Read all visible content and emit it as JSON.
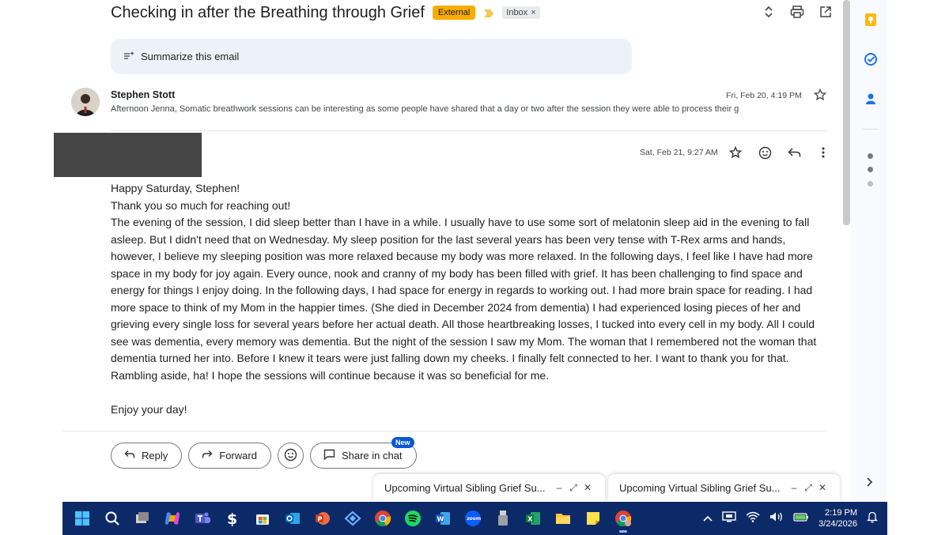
{
  "subject": {
    "title": "Checking in after the Breathing through Grief",
    "external_badge": "External",
    "inbox_label": "Inbox",
    "inbox_remove": "×"
  },
  "summarize": {
    "label": "Summarize this email"
  },
  "message1": {
    "sender": "Stephen Stott",
    "snippet": "Afternoon Jenna, Somatic breathwork sessions can be interesting as some people have shared that a day or two after the session they were able to process their g",
    "date": "Fri, Feb 20, 4:19 PM"
  },
  "message2": {
    "date": "Sat, Feb 21, 9:27 AM",
    "body": [
      "Happy Saturday, Stephen!",
      "Thank you so much for reaching out!",
      "The evening of the session, I did sleep better than I have in a while.  I usually have to use some sort of melatonin sleep aid in the evening to fall asleep.  But I didn't need that on Wednesday.  My sleep position for the last several years has been very tense with T-Rex arms and hands, however, I believe my sleeping position was more relaxed because my body was more relaxed.  In the following days, I feel like I have had more space in my body for joy again.  Every ounce, nook and cranny of my body has been filled with grief.  It has been challenging to find space and energy for things I enjoy doing.  In the following days, I had space for energy in regards to working out.  I had more brain space for reading.  I had more space to think of my Mom in the happier times. (She died in December 2024 from dementia)  I had experienced losing pieces of her and grieving every single loss for several years before her actual death.  All those heartbreaking losses, I tucked into every cell in my body.  All I could see was dementia, every memory was dementia.  But the night of the session I saw my Mom.  The woman that I remembered not the woman that dementia turned her into.  Before I knew it tears were just falling down my cheeks.  I finally felt connected to her.  I want to thank you for that.",
      "Rambling aside, ha!  I hope the sessions will continue because it was so beneficial for me."
    ],
    "closing": "Enjoy your day!"
  },
  "reply_bar": {
    "reply": "Reply",
    "forward": "Forward",
    "share": "Share in chat",
    "new_badge": "New"
  },
  "chat_popups": [
    {
      "title": "Upcoming Virtual Sibling Grief Su..."
    },
    {
      "title": "Upcoming Virtual Sibling Grief Su..."
    }
  ],
  "taskbar": {
    "time": "2:19 PM",
    "date": "3/24/2026",
    "icons": [
      "windows-start-icon",
      "search-icon",
      "task-view-icon",
      "copilot-icon",
      "teams-icon",
      "dollar-app-icon",
      "ms-store-icon",
      "outlook-icon",
      "powerpoint-icon",
      "vpn-icon",
      "chrome-icon",
      "spotify-icon",
      "word-icon",
      "zoom-icon",
      "usb-device-icon",
      "excel-icon",
      "file-explorer-icon",
      "sticky-notes-icon",
      "chrome-active-icon"
    ]
  },
  "colors": {
    "external_badge": "#f9ab00",
    "summarize_bg": "#edf2fa",
    "taskbar_bg": "#0d2a68",
    "new_badge": "#0b57d0"
  }
}
